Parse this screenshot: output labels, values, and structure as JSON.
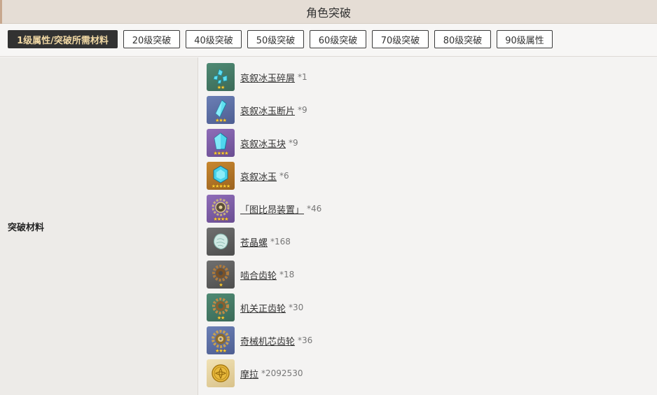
{
  "header": {
    "title": "角色突破"
  },
  "tabs": [
    {
      "label": "1级属性/突破所需材料",
      "active": true
    },
    {
      "label": "20级突破",
      "active": false
    },
    {
      "label": "40级突破",
      "active": false
    },
    {
      "label": "50级突破",
      "active": false
    },
    {
      "label": "60级突破",
      "active": false
    },
    {
      "label": "70级突破",
      "active": false
    },
    {
      "label": "80级突破",
      "active": false
    },
    {
      "label": "90级属性",
      "active": false
    }
  ],
  "section": {
    "label": "突破材料"
  },
  "materials": [
    {
      "name": "哀叙冰玉碎屑",
      "count": "*1",
      "rarity": 2,
      "icon": "ice-gem-sliver-icon"
    },
    {
      "name": "哀叙冰玉断片",
      "count": "*9",
      "rarity": 3,
      "icon": "ice-gem-fragment-icon"
    },
    {
      "name": "哀叙冰玉块",
      "count": "*9",
      "rarity": 4,
      "icon": "ice-gem-chunk-icon"
    },
    {
      "name": "哀叙冰玉",
      "count": "*6",
      "rarity": 5,
      "icon": "ice-gem-icon"
    },
    {
      "name": "「图比昂装置」",
      "count": "*46",
      "rarity": 4,
      "icon": "tourbillon-device-icon"
    },
    {
      "name": "苍晶螺",
      "count": "*168",
      "rarity": 0,
      "icon": "crystal-shell-icon"
    },
    {
      "name": "啮合齿轮",
      "count": "*18",
      "rarity": 1,
      "icon": "meshing-gear-icon"
    },
    {
      "name": "机关正齿轮",
      "count": "*30",
      "rarity": 2,
      "icon": "spur-gear-icon"
    },
    {
      "name": "奇械机芯齿轮",
      "count": "*36",
      "rarity": 3,
      "icon": "mechanical-gear-icon"
    },
    {
      "name": "摩拉",
      "count": "*2092530",
      "rarity": 0,
      "icon": "mora-coin-icon"
    }
  ]
}
